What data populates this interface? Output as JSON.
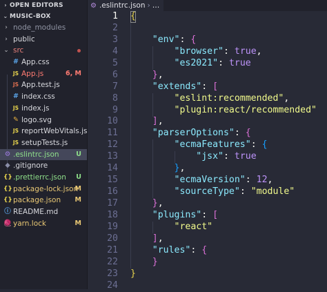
{
  "sidebar": {
    "open_editors_label": "OPEN EDITORS",
    "project_label": "MUSIC-BOX",
    "items": [
      {
        "name": "node_modules",
        "type": "folder",
        "depth": 0,
        "expanded": false,
        "color": "#8f93a2",
        "badge": "",
        "modified_dot": false,
        "active": false
      },
      {
        "name": "public",
        "type": "folder",
        "depth": 0,
        "expanded": false,
        "color": "#d8d9de",
        "badge": "",
        "modified_dot": false,
        "active": false
      },
      {
        "name": "src",
        "type": "folder",
        "depth": 0,
        "expanded": true,
        "color": "#e8807b",
        "badge": "",
        "modified_dot": true,
        "active": false
      },
      {
        "name": "App.css",
        "type": "file",
        "icon": "#",
        "icon_name": "css-icon",
        "icon_color": "#5aa4e8",
        "depth": 1,
        "color": "#d8d9de",
        "badge": "",
        "modified_dot": false,
        "active": false
      },
      {
        "name": "App.js",
        "type": "file",
        "icon": "JS",
        "icon_name": "js-icon",
        "icon_color": "#e8d44d",
        "depth": 1,
        "color": "#ff7b72",
        "badge": "6, M",
        "badge_color": "#ff7b72",
        "modified_dot": false,
        "active": false
      },
      {
        "name": "App.test.js",
        "type": "file",
        "icon": "JS",
        "icon_name": "test-js-icon",
        "icon_color": "#e07050",
        "depth": 1,
        "color": "#d8d9de",
        "badge": "",
        "modified_dot": false,
        "active": false
      },
      {
        "name": "index.css",
        "type": "file",
        "icon": "#",
        "icon_name": "css-icon",
        "icon_color": "#5aa4e8",
        "depth": 1,
        "color": "#d8d9de",
        "badge": "",
        "modified_dot": false,
        "active": false
      },
      {
        "name": "index.js",
        "type": "file",
        "icon": "JS",
        "icon_name": "js-icon",
        "icon_color": "#e8d44d",
        "depth": 1,
        "color": "#d8d9de",
        "badge": "",
        "modified_dot": false,
        "active": false
      },
      {
        "name": "logo.svg",
        "type": "file",
        "icon": "✎",
        "icon_name": "svg-icon",
        "icon_color": "#e8b040",
        "depth": 1,
        "color": "#d8d9de",
        "badge": "",
        "modified_dot": false,
        "active": false
      },
      {
        "name": "reportWebVitals.js",
        "type": "file",
        "icon": "JS",
        "icon_name": "js-icon",
        "icon_color": "#e8d44d",
        "depth": 1,
        "color": "#d8d9de",
        "badge": "",
        "modified_dot": false,
        "active": false
      },
      {
        "name": "setupTests.js",
        "type": "file",
        "icon": "JS",
        "icon_name": "js-icon",
        "icon_color": "#e8d44d",
        "depth": 1,
        "color": "#d8d9de",
        "badge": "",
        "modified_dot": false,
        "active": false
      },
      {
        "name": ".eslintrc.json",
        "type": "file",
        "icon": "⚙",
        "icon_name": "eslint-icon",
        "icon_color": "#9d7be0",
        "depth": 0,
        "color": "#8fe08a",
        "badge": "U",
        "badge_color": "#8fe08a",
        "modified_dot": false,
        "active": true
      },
      {
        "name": ".gitignore",
        "type": "file",
        "icon": "◆",
        "icon_name": "git-icon",
        "icon_color": "#8a8ea8",
        "depth": 0,
        "color": "#d8d9de",
        "badge": "",
        "modified_dot": false,
        "active": false
      },
      {
        "name": ".prettierrc.json",
        "type": "file",
        "icon": "{}",
        "icon_name": "json-icon",
        "icon_color": "#e8d44d",
        "depth": 0,
        "color": "#8fe08a",
        "badge": "U",
        "badge_color": "#8fe08a",
        "modified_dot": false,
        "active": false
      },
      {
        "name": "package-lock.json",
        "type": "file",
        "icon": "{}",
        "icon_name": "json-icon",
        "icon_color": "#e8d44d",
        "depth": 0,
        "color": "#e8c774",
        "badge": "M",
        "badge_color": "#e8c774",
        "modified_dot": false,
        "active": false
      },
      {
        "name": "package.json",
        "type": "file",
        "icon": "{}",
        "icon_name": "json-icon",
        "icon_color": "#e8d44d",
        "depth": 0,
        "color": "#e8c774",
        "badge": "M",
        "badge_color": "#e8c774",
        "modified_dot": false,
        "active": false
      },
      {
        "name": "README.md",
        "type": "file",
        "icon": "ⓘ",
        "icon_name": "info-icon",
        "icon_color": "#5aa4e8",
        "depth": 0,
        "color": "#d8d9de",
        "badge": "",
        "modified_dot": false,
        "active": false
      },
      {
        "name": "yarn.lock",
        "type": "file",
        "icon": "🧶",
        "icon_name": "yarn-icon",
        "icon_color": "#5aa4e8",
        "depth": 0,
        "color": "#e8c774",
        "badge": "M",
        "badge_color": "#e8c774",
        "modified_dot": false,
        "active": false
      }
    ]
  },
  "editor": {
    "tab_label": ".eslintrc.json",
    "breadcrumb_ellipsis": "…",
    "cursor_line": 1,
    "colors": {
      "punct": "#f8f8f2",
      "bracket1": "#e8d44d",
      "bracket2": "#da70d6",
      "bracket3": "#179fff",
      "key": "#8be9fd",
      "string": "#f1fa8c",
      "boolean": "#bd93f9",
      "number": "#bd93f9"
    },
    "lines": [
      [
        [
          "{",
          "bracket1"
        ]
      ],
      [],
      [
        [
          "    ",
          ""
        ],
        [
          "\"env\"",
          "key"
        ],
        [
          ": ",
          "punct"
        ],
        [
          "{",
          "bracket2"
        ]
      ],
      [
        [
          "        ",
          ""
        ],
        [
          "\"browser\"",
          "key"
        ],
        [
          ": ",
          "punct"
        ],
        [
          "true",
          "boolean"
        ],
        [
          ",",
          "punct"
        ]
      ],
      [
        [
          "        ",
          ""
        ],
        [
          "\"es2021\"",
          "key"
        ],
        [
          ": ",
          "punct"
        ],
        [
          "true",
          "boolean"
        ]
      ],
      [
        [
          "    ",
          ""
        ],
        [
          "}",
          "bracket2"
        ],
        [
          ",",
          "punct"
        ]
      ],
      [
        [
          "    ",
          ""
        ],
        [
          "\"extends\"",
          "key"
        ],
        [
          ": ",
          "punct"
        ],
        [
          "[",
          "bracket2"
        ]
      ],
      [
        [
          "        ",
          ""
        ],
        [
          "\"eslint:recommended\"",
          "string"
        ],
        [
          ",",
          "punct"
        ]
      ],
      [
        [
          "        ",
          ""
        ],
        [
          "\"plugin:react/recommended\"",
          "string"
        ]
      ],
      [
        [
          "    ",
          ""
        ],
        [
          "]",
          "bracket2"
        ],
        [
          ",",
          "punct"
        ]
      ],
      [
        [
          "    ",
          ""
        ],
        [
          "\"parserOptions\"",
          "key"
        ],
        [
          ": ",
          "punct"
        ],
        [
          "{",
          "bracket2"
        ]
      ],
      [
        [
          "        ",
          ""
        ],
        [
          "\"ecmaFeatures\"",
          "key"
        ],
        [
          ": ",
          "punct"
        ],
        [
          "{",
          "bracket3"
        ]
      ],
      [
        [
          "            ",
          ""
        ],
        [
          "\"jsx\"",
          "key"
        ],
        [
          ": ",
          "punct"
        ],
        [
          "true",
          "boolean"
        ]
      ],
      [
        [
          "        ",
          ""
        ],
        [
          "}",
          "bracket3"
        ],
        [
          ",",
          "punct"
        ]
      ],
      [
        [
          "        ",
          ""
        ],
        [
          "\"ecmaVersion\"",
          "key"
        ],
        [
          ": ",
          "punct"
        ],
        [
          "12",
          "number"
        ],
        [
          ",",
          "punct"
        ]
      ],
      [
        [
          "        ",
          ""
        ],
        [
          "\"sourceType\"",
          "key"
        ],
        [
          ": ",
          "punct"
        ],
        [
          "\"module\"",
          "string"
        ]
      ],
      [
        [
          "    ",
          ""
        ],
        [
          "}",
          "bracket2"
        ],
        [
          ",",
          "punct"
        ]
      ],
      [
        [
          "    ",
          ""
        ],
        [
          "\"plugins\"",
          "key"
        ],
        [
          ": ",
          "punct"
        ],
        [
          "[",
          "bracket2"
        ]
      ],
      [
        [
          "        ",
          ""
        ],
        [
          "\"react\"",
          "string"
        ]
      ],
      [
        [
          "    ",
          ""
        ],
        [
          "]",
          "bracket2"
        ],
        [
          ",",
          "punct"
        ]
      ],
      [
        [
          "    ",
          ""
        ],
        [
          "\"rules\"",
          "key"
        ],
        [
          ": ",
          "punct"
        ],
        [
          "{",
          "bracket2"
        ]
      ],
      [
        [
          "    ",
          ""
        ],
        [
          "}",
          "bracket2"
        ]
      ],
      [
        [
          "}",
          "bracket1"
        ]
      ],
      []
    ]
  }
}
